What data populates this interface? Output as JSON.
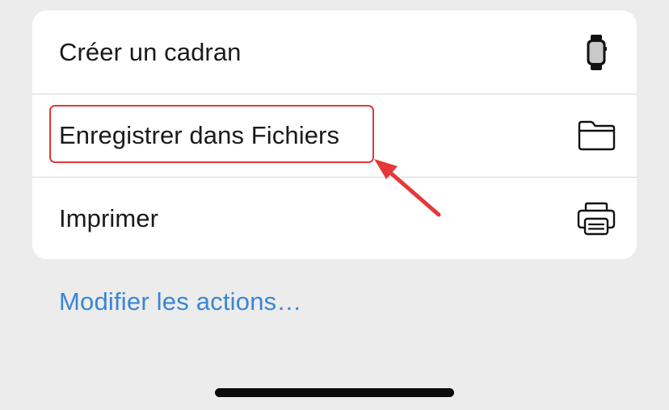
{
  "menu": {
    "items": [
      {
        "label": "Créer un cadran",
        "icon": "watch-icon"
      },
      {
        "label": "Enregistrer dans Fichiers",
        "icon": "folder-icon"
      },
      {
        "label": "Imprimer",
        "icon": "printer-icon"
      }
    ]
  },
  "footer": {
    "edit_actions_label": "Modifier les actions…"
  },
  "colors": {
    "link": "#3a86d4",
    "annotation": "#e53838",
    "background": "#ececec",
    "card": "#ffffff"
  }
}
